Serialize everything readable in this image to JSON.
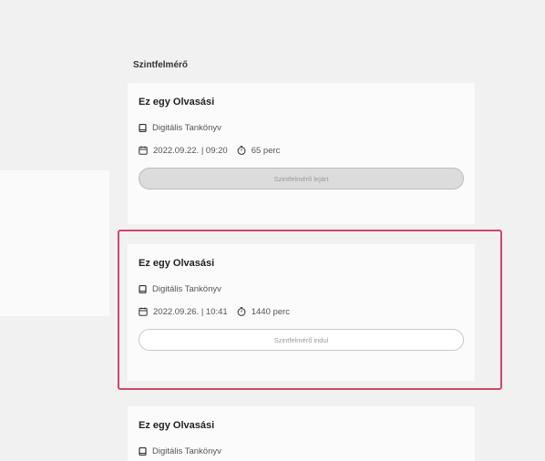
{
  "section_title": "Szintfelmérő",
  "cards": [
    {
      "title": "Ez egy Olvasási",
      "source": "Digitális Tankönyv",
      "datetime": "2022.09.22. | 09:20",
      "duration": "65 perc",
      "button_label": "Szintfelmérő lejárt",
      "button_state": "disabled"
    },
    {
      "title": "Ez egy Olvasási",
      "source": "Digitális Tankönyv",
      "datetime": "2022.09.26. | 10:41",
      "duration": "1440 perc",
      "button_label": "Szintfelmérő indul",
      "button_state": "enabled",
      "highlighted": true
    },
    {
      "title": "Ez egy Olvasási",
      "source": "Digitális Tankönyv"
    }
  ],
  "colors": {
    "highlight": "#d0466c",
    "background": "#f1f1f1",
    "card": "#fbfbfb"
  },
  "icons": {
    "source": "book-icon",
    "date": "calendar-icon",
    "duration": "clock-icon"
  }
}
